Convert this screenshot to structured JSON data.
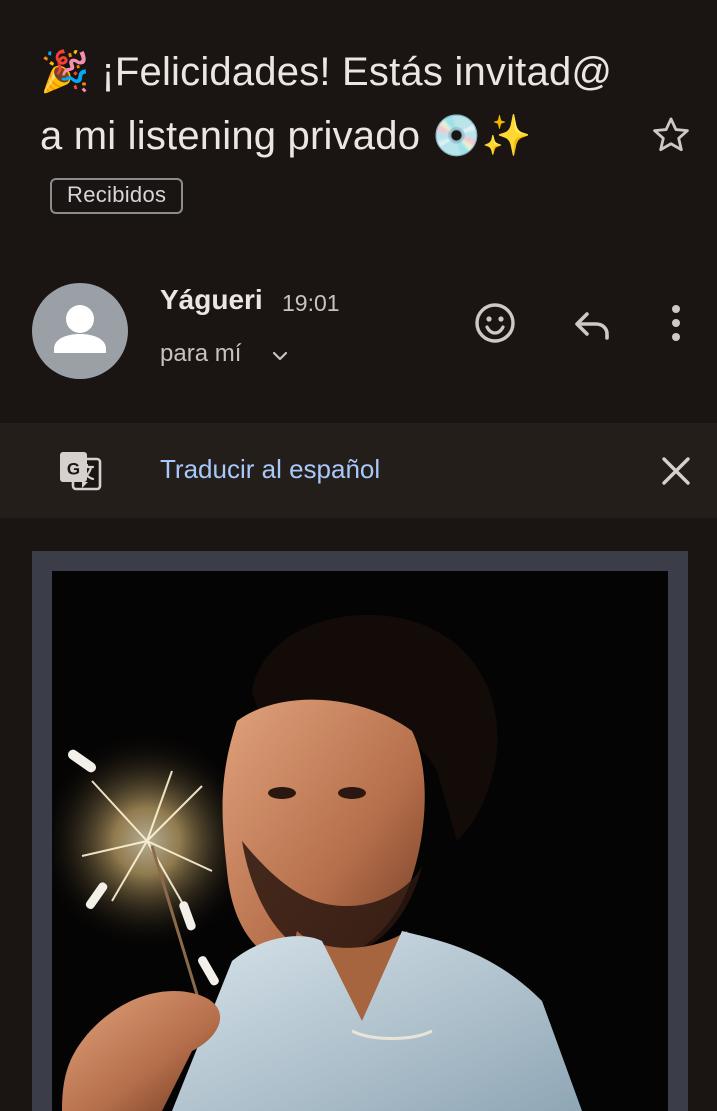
{
  "email": {
    "subject_prefix_emoji": "🎉",
    "subject_text": "¡Felicidades! Estás invitad@ a mi listening privado",
    "subject_suffix_emoji": "💿✨",
    "label_chip": "Recibidos",
    "star_icon": "star-outline-icon"
  },
  "sender": {
    "name": "Yágueri",
    "time": "19:01",
    "recipient": "para mí",
    "avatar_icon": "default-person-icon"
  },
  "actions": {
    "react_icon": "emoji-smile-icon",
    "reply_icon": "reply-icon",
    "more_icon": "more-vertical-icon"
  },
  "translate": {
    "link_text": "Traducir al español",
    "icon": "google-translate-icon",
    "close_icon": "close-icon"
  },
  "body": {
    "image": "promo-photo-man-with-sparkler"
  },
  "colors": {
    "background": "#1a1513",
    "translate_bar": "#241e1b",
    "link": "#a8c7fa",
    "frame": "#3b3d48"
  }
}
